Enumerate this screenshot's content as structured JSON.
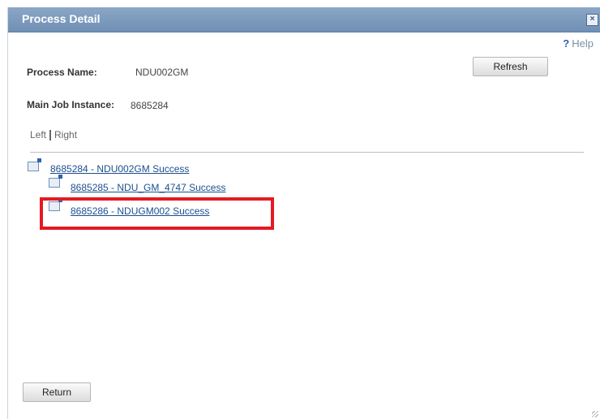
{
  "window": {
    "title": "Process Detail",
    "close_icon": "close-icon"
  },
  "help_label": "Help",
  "fields": {
    "process_name_label": "Process Name:",
    "process_name_value": "NDU002GM",
    "main_job_label": "Main Job Instance:",
    "main_job_value": "8685284"
  },
  "buttons": {
    "refresh": "Refresh",
    "return": "Return"
  },
  "view_toggle": {
    "left": "Left",
    "right": "Right"
  },
  "tree": {
    "root": "8685284 - NDU002GM Success",
    "children": [
      "8685285 - NDU_GM_4747 Success",
      "8685286 - NDUGM002 Success"
    ]
  },
  "colors": {
    "title_bar": "#7896b9",
    "link": "#1c4f8f",
    "highlight": "#e31b23"
  }
}
